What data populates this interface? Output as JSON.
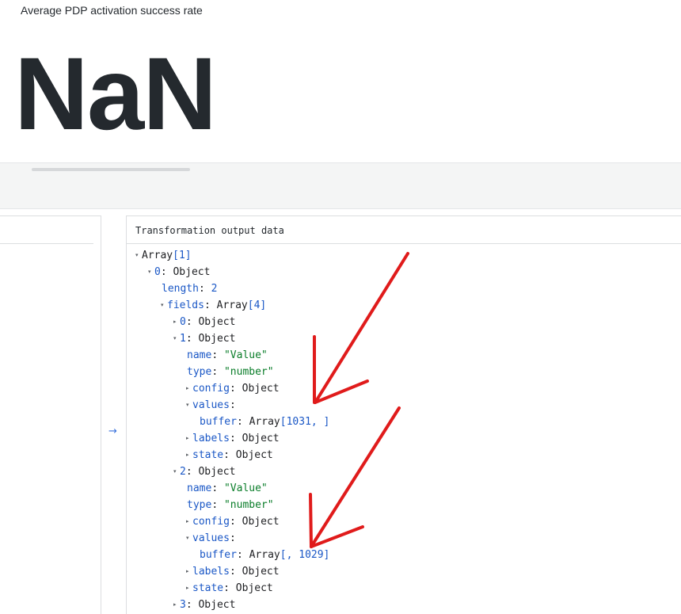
{
  "panel": {
    "title": "Average PDP activation success rate",
    "value": "NaN"
  },
  "output": {
    "title": "Transformation output data"
  },
  "tree": {
    "root_key": "Array",
    "root_count": "[1]",
    "obj0_key": "0",
    "obj_type": "Object",
    "length_key": "length",
    "length_val": "2",
    "fields_key": "fields",
    "fields_type": "Array",
    "fields_count": "[4]",
    "f0_key": "0",
    "f1_key": "1",
    "f2_key": "2",
    "f3_key": "3",
    "name_key": "name",
    "type_key": "type",
    "config_key": "config",
    "values_key": "values",
    "buffer_key": "buffer",
    "labels_key": "labels",
    "state_key": "state",
    "f1_name": "\"Value\"",
    "f1_type": "\"number\"",
    "f1_buffer_type": "Array",
    "f1_buffer_val": "[1031, ]",
    "f2_name": "\"Value\"",
    "f2_type": "\"number\"",
    "f2_buffer_type": "Array",
    "f2_buffer_val": "[, 1029]"
  },
  "icons": {
    "expanded": "▾",
    "collapsed": "▸",
    "arrow": "→"
  },
  "colors": {
    "annotation_arrow": "#e01b1b",
    "number": "#1a57c6",
    "string": "#0a7d29"
  }
}
